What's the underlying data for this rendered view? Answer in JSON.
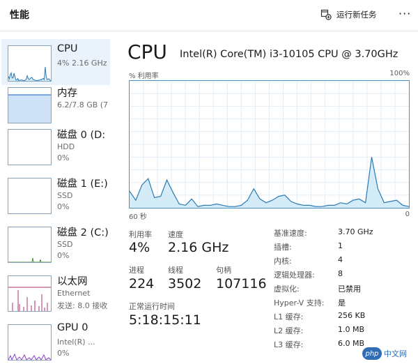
{
  "header": {
    "title": "性能",
    "run_task_label": "运行新任务",
    "more_label": "···"
  },
  "sidebar": {
    "items": [
      {
        "name": "CPU",
        "sub1": "4% 2.16 GHz",
        "sub2": ""
      },
      {
        "name": "内存",
        "sub1": "6.2/7.8 GB (7",
        "sub2": ""
      },
      {
        "name": "磁盘 0 (D:",
        "sub1": "HDD",
        "sub2": "0%"
      },
      {
        "name": "磁盘 1 (E:)",
        "sub1": "SSD",
        "sub2": "0%"
      },
      {
        "name": "磁盘 2 (C:)",
        "sub1": "SSD",
        "sub2": "0%"
      },
      {
        "name": "以太网",
        "sub1": "Ethernet",
        "sub2": "发送: 8.0 接收"
      },
      {
        "name": "GPU 0",
        "sub1": "Intel(R) ...",
        "sub2": "0%"
      }
    ]
  },
  "main": {
    "title": "CPU",
    "model": "Intel(R) Core(TM) i3-10105 CPU @ 3.70GHz",
    "graph_label_left": "% 利用率",
    "graph_label_right": "100%",
    "time_left": "60 秒",
    "time_right": "0",
    "stats": {
      "utilization_label": "利用率",
      "utilization_value": "4%",
      "speed_label": "速度",
      "speed_value": "2.16 GHz",
      "processes_label": "进程",
      "processes_value": "224",
      "threads_label": "线程",
      "threads_value": "3502",
      "handles_label": "句柄",
      "handles_value": "107116",
      "uptime_label": "正常运行时间",
      "uptime_value": "5:18:15:11"
    },
    "details": [
      {
        "label": "基准速度:",
        "value": "3.70 GHz"
      },
      {
        "label": "插槽:",
        "value": "1"
      },
      {
        "label": "内核:",
        "value": "4"
      },
      {
        "label": "逻辑处理器:",
        "value": "8"
      },
      {
        "label": "虚拟化:",
        "value": "已禁用"
      },
      {
        "label": "Hyper-V 支持:",
        "value": "是"
      },
      {
        "label": "L1 缓存:",
        "value": "256 KB"
      },
      {
        "label": "L2 缓存:",
        "value": "1.0 MB"
      },
      {
        "label": "L3 缓存:",
        "value": "6.0 MB"
      }
    ]
  },
  "cpu_history": [
    13,
    6,
    18,
    23,
    8,
    9,
    22,
    12,
    3,
    2,
    7,
    1,
    2,
    2,
    3,
    2,
    1,
    1,
    2,
    6,
    15,
    7,
    4,
    6,
    9,
    10,
    5,
    3,
    2,
    2,
    1,
    1,
    2,
    2,
    4,
    3,
    6,
    7,
    4,
    40,
    15,
    4,
    5,
    6,
    2,
    1
  ],
  "watermark": {
    "logo": "php",
    "text": "中文网"
  },
  "colors": {
    "accent": "#4a8fc4",
    "cpu_fill": "#d4ecf7",
    "cpu_line": "#2a7ab5",
    "memory_fill": "#cfe1f7",
    "network_line": "#b0306b",
    "disk_line": "#4c8c3c",
    "gpu_line": "#8a3fcf"
  }
}
